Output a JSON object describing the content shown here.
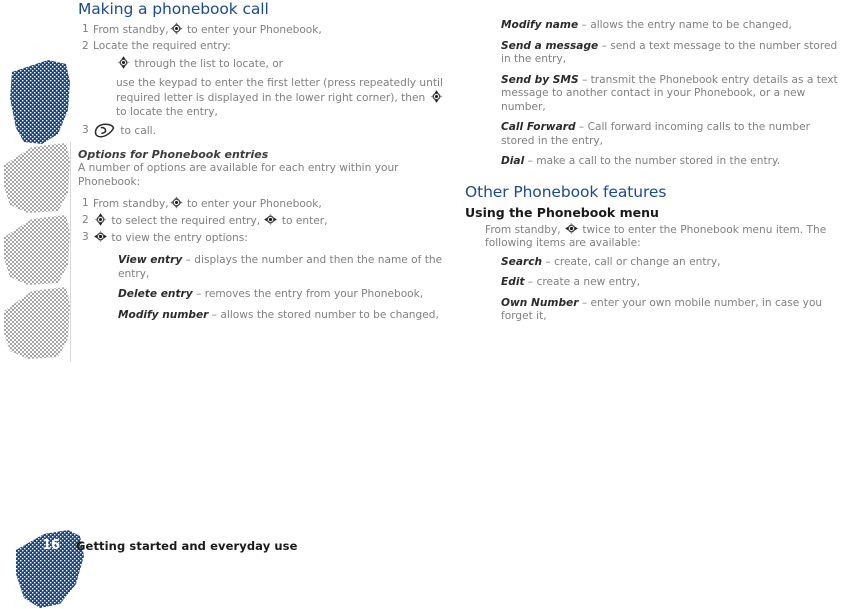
{
  "document": {
    "page_number": "16",
    "footer_title": "Getting started and everyday use",
    "accent_blue": "#1b4b8f",
    "body_gray": "#808080"
  },
  "left_column": {
    "heading": "Making a phonebook call",
    "steps": [
      {
        "num": "1",
        "text_before": "From standby,",
        "icon": "nav-key-all",
        "text_after": "to enter your Phonebook,"
      },
      {
        "num": "2",
        "text_before": "Locate the required entry:",
        "icon": "",
        "text_after": ""
      },
      {
        "num": "3",
        "text_before": "",
        "icon": "call-key",
        "text_after": "to call."
      }
    ],
    "step2_sub_a_icon": "nav-key-vertical",
    "step2_sub_a_text": "through the list to locate, or",
    "step2_sub_b_before": "use the keypad to enter the first letter (press repeatedly until required letter is displayed in the lower right corner), then",
    "step2_sub_b_icon": "nav-key-vertical",
    "step2_sub_b_after": "to locate the entry,",
    "options_heading": "Options for Phonebook entries",
    "options_intro": "A number of options are available for each entry within your Phonebook:",
    "options_steps": [
      {
        "num": "1",
        "before": "From standby,",
        "icon1": "nav-key-all",
        "mid": "to enter your Phonebook,",
        "icon2": "",
        "after": ""
      },
      {
        "num": "2",
        "before": "",
        "icon1": "nav-key-vertical",
        "mid": "to select the required entry,",
        "icon2": "nav-key-horizontal",
        "after": "to enter,"
      },
      {
        "num": "3",
        "before": "",
        "icon1": "nav-key-horizontal",
        "mid": "to view the entry options:",
        "icon2": "",
        "after": ""
      }
    ],
    "definitions": [
      {
        "term": "View entry",
        "dash": "–",
        "desc": "displays the number and then the name of the entry,"
      },
      {
        "term": "Delete entry",
        "dash": "–",
        "desc": "removes the entry from your Phonebook,"
      },
      {
        "term": "Modify number",
        "dash": "–",
        "desc": "allows the stored number to be changed,"
      }
    ]
  },
  "right_column": {
    "definitions_continued": [
      {
        "term": "Modify name",
        "dash": "–",
        "desc": "allows the entry name to be changed,"
      },
      {
        "term": "Send a message",
        "dash": "–",
        "desc": "send a text message to the number stored in the entry,"
      },
      {
        "term": "Send by SMS",
        "dash": "–",
        "desc": "transmit the Phonebook entry details as a text message to another contact in your Phonebook, or a new number,"
      },
      {
        "term": "Call Forward",
        "dash": "–",
        "desc": "Call forward incoming calls to the number stored in the entry,"
      },
      {
        "term": "Dial",
        "dash": "–",
        "desc": "make a call to the number stored in the entry."
      }
    ],
    "heading": "Other Phonebook features",
    "subheading": "Using the Phonebook menu",
    "intro_before": "From standby,",
    "intro_icon": "nav-key-horizontal",
    "intro_after": "twice to enter the Phonebook menu item. The following items are available:",
    "menu_items": [
      {
        "term": "Search",
        "dash": "–",
        "desc": "create, call or change an entry,"
      },
      {
        "term": "Edit",
        "dash": "–",
        "desc": "create a new entry,"
      },
      {
        "term": "Own Number",
        "dash": "–",
        "desc": "enter your own mobile number, in case you forget it,"
      }
    ]
  }
}
